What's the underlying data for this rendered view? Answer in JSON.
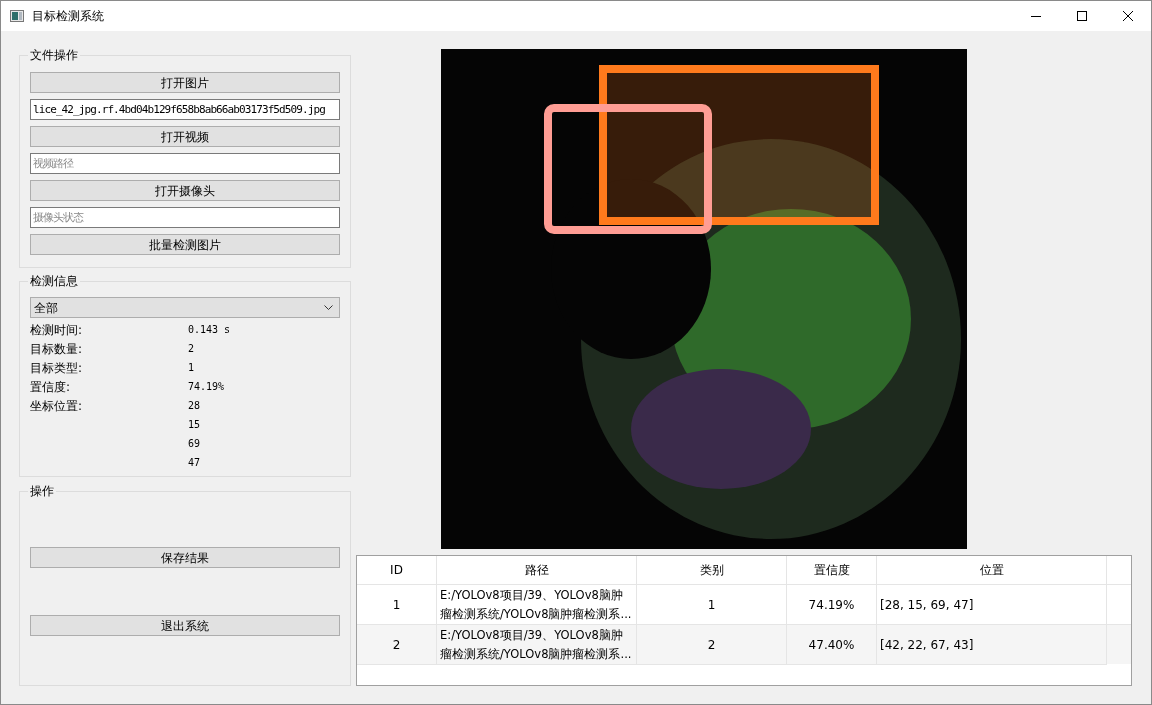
{
  "window": {
    "title": "目标检测系统"
  },
  "file_ops": {
    "title": "文件操作",
    "items": [
      {
        "kind": "button",
        "label": "打开图片"
      },
      {
        "kind": "field",
        "value": "lice_42_jpg.rf.4bd04b129f658b8ab66ab03173f5d509.jpg"
      },
      {
        "kind": "button",
        "label": "打开视频"
      },
      {
        "kind": "field",
        "placeholder": "视频路径"
      },
      {
        "kind": "button",
        "label": "打开摄像头"
      },
      {
        "kind": "field",
        "placeholder": "摄像头状态"
      },
      {
        "kind": "button",
        "label": "批量检测图片"
      }
    ]
  },
  "detection_info": {
    "title": "检测信息",
    "dropdown": {
      "value": "全部"
    },
    "rows": [
      {
        "label": "检测时间:",
        "value": "0.143 s"
      },
      {
        "label": "目标数量:",
        "value": "2"
      },
      {
        "label": "目标类型:",
        "value": "1"
      },
      {
        "label": "置信度:",
        "value": "74.19%"
      },
      {
        "label": "坐标位置:",
        "value": "28"
      },
      {
        "value": "15"
      },
      {
        "value": "69"
      },
      {
        "value": "47"
      }
    ]
  },
  "operations": {
    "title": "操作",
    "buttons": [
      "保存结果",
      "退出系统"
    ]
  },
  "table": {
    "columns": [
      "ID",
      "路径",
      "类别",
      "置信度",
      "位置"
    ],
    "rows": [
      [
        "1",
        "E:/YOLOv8项目/39、YOLOv8脑肿瘤检测系统/YOLOv8脑肿瘤检测系...",
        "1",
        "74.19%",
        "[28, 15, 69, 47]"
      ],
      [
        "2",
        "E:/YOLOv8项目/39、YOLOv8脑肿瘤检测系统/YOLOv8脑肿瘤检测系...",
        "2",
        "47.40%",
        "[42, 22, 67, 43]"
      ]
    ]
  }
}
